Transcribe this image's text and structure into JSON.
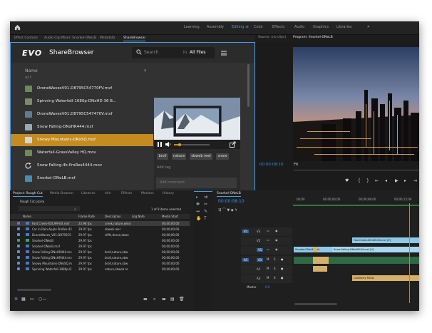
{
  "workspaces": {
    "items": [
      "Learning",
      "Assembly",
      "Editing",
      "Color",
      "Effects",
      "Audio",
      "Graphics",
      "Libraries"
    ],
    "active": "Editing",
    "more": "»"
  },
  "source_tabs": [
    "Effect Controls",
    "Audio Clip Mixer: Snorkel-ONeLB",
    "Metadata",
    "ShareBrowser"
  ],
  "sharebrowser": {
    "brand": "EVO",
    "title": "ShareBrowser",
    "search_placeholder": "Search",
    "in_label": "in",
    "scope": "All Files",
    "list_header": "Name",
    "sort_label": "az↑",
    "files": [
      {
        "name": "DroneWavesV01.D8795C54770FV.mxf",
        "color": "#6b8a5a"
      },
      {
        "name": "Spinning Waterfall-1080p-DNxHD 36 B...",
        "color": "#7a8c6a"
      },
      {
        "name": "DroneWavesV01.D8795C547470V.mxf",
        "color": "#5d7f8d"
      },
      {
        "name": "Snow Falling-DNxHR444.mxf",
        "color": "#9aa7b5"
      },
      {
        "name": "Snowy Mountains-DNxSQ.mxf",
        "color": "#cfd6de",
        "selected": true
      },
      {
        "name": "Waterfall-GrassValley HQ.mov",
        "color": "#6c8b55"
      },
      {
        "name": "Snow Falling-4k-ProRes4444.mov",
        "color": "#888888",
        "icon": "refresh"
      },
      {
        "name": "Snorkel-ONeLB.mxf",
        "color": "#4d8ab0"
      }
    ],
    "tags": [
      "broll",
      "nature",
      "sbweb reel",
      "snow"
    ],
    "add_tag": "Add tag",
    "add_comment": "Add comment"
  },
  "monitors": {
    "source_label": "Source: (no clips)",
    "program_label": "Program: Snorkel-ONeLB",
    "timecode": "00:00:08:10",
    "fit": "Fit"
  },
  "project": {
    "tabs": [
      "Project: Rough Cut",
      "Media Browser",
      "Libraries",
      "Info",
      "Effects",
      "Markers",
      "History"
    ],
    "file_label": "Rough Cut.prproj",
    "selected_count": "1 of 9 items selected",
    "columns": [
      "Name",
      "Frame Rate",
      "Description",
      "Log Note",
      "Media Start"
    ],
    "rows": [
      {
        "name": "Fast Creek-XOCAM-EX.mxf",
        "fps": "23.98 fps",
        "desc": "creek,nature,wind",
        "start": "00;00;00;00",
        "cb": "#7b65c9"
      },
      {
        "name": "Car In Rain-Apple ProRes 42",
        "fps": "29.97 fps",
        "desc": "sbweb reel",
        "start": "00;00;00;00",
        "cb": "#5f8fd6"
      },
      {
        "name": "DroneWaves_V01.D8795C5",
        "fps": "29.97 fps",
        "desc": "cliffs,drone,sbwe",
        "start": "00;00;00;00",
        "cb": "#5f8fd6"
      },
      {
        "name": "Snorkel-ONeLB",
        "fps": "29.97 fps",
        "desc": "",
        "start": "00;00;00;00",
        "cb": "#3fa55b"
      },
      {
        "name": "Snorkel-ONeLB.mxf",
        "fps": "29.97 fps",
        "desc": "",
        "start": "00;00;00;00",
        "cb": "#5f8fd6"
      },
      {
        "name": "Snow Falling-DNxHR444.mx",
        "fps": "29.97 fps",
        "desc": "broll,nature,sbw",
        "start": "00;00;00;00",
        "cb": "#5f8fd6"
      },
      {
        "name": "Snow Falling-DNxHR444.mx",
        "fps": "29.97 fps",
        "desc": "broll,nature,sbw",
        "start": "00;00;00;00",
        "cb": "#5f8fd6"
      },
      {
        "name": "Snowy Mountains-DNxSQ.m",
        "fps": "29.97 fps",
        "desc": "broll,nature,sbw",
        "start": "00;00;00;00",
        "cb": "#5f8fd6"
      },
      {
        "name": "Spinning Waterfall-1080p-D",
        "fps": "29.97 fps",
        "desc": "nature,sbweb re",
        "start": "00;00;00;00",
        "cb": "#5f8fd6"
      }
    ]
  },
  "timeline": {
    "sequence": "Snorkel-ONeLB",
    "timecode": "00:00:08:10",
    "ruler": [
      "00;00",
      "00;00;04;00",
      "00;00;08;00",
      "00;00;12;00"
    ],
    "video_tracks": [
      "V3",
      "V2",
      "V1"
    ],
    "audio_tracks": [
      "A1",
      "A2",
      "A3"
    ],
    "master": "Master",
    "master_value": "0.0",
    "clips": [
      {
        "label": "Fast Creek-XOCAM-EX.mxf [V]",
        "track": "v2",
        "color": "#8ec9e8"
      },
      {
        "label": "Snorkel-ONeLB.mxf",
        "track": "v1a",
        "color": "#8ec9e8"
      },
      {
        "label": "Snow Falling-DNxHR444.mxf [V]",
        "track": "v1b",
        "color": "#a7d8ef"
      },
      {
        "label": "Cranberry Fields",
        "track": "a2",
        "color": "#d4b06a"
      }
    ]
  }
}
